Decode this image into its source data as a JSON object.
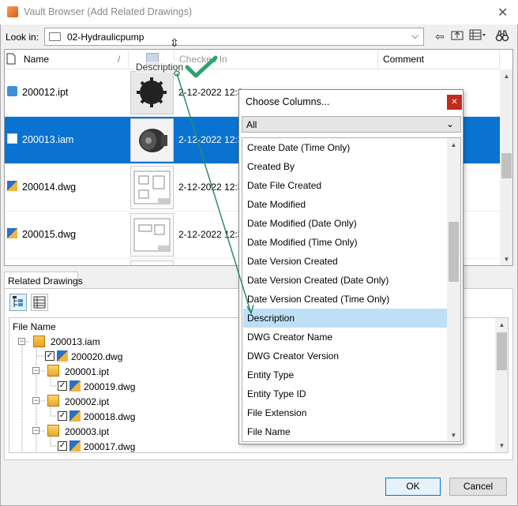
{
  "window": {
    "title": "Vault Browser (Add Related Drawings)",
    "close": "✕"
  },
  "lookin": {
    "label": "Look in:",
    "value": "02-Hydraulicpump",
    "chevron": "⌄"
  },
  "toolbar": {
    "back_icon": "⇦",
    "up_icon": "⇧",
    "views_icon": "☷",
    "find_icon": "binoculars-icon"
  },
  "grid": {
    "columns": [
      "Name",
      "",
      "Checked In",
      "Comment"
    ],
    "rows": [
      {
        "name": "200012.ipt",
        "date": "2-12-2022 12:3",
        "selected": false
      },
      {
        "name": "200013.iam",
        "date": "2-12-2022 12:3",
        "selected": true
      },
      {
        "name": "200014.dwg",
        "date": "2-12-2022 12:3",
        "selected": false
      },
      {
        "name": "200015.dwg",
        "date": "2-12-2022 12:3",
        "selected": false
      }
    ],
    "drag_label": "Description"
  },
  "related": {
    "tab_label": "Related Drawings",
    "tree_header": "File Name",
    "tree": [
      {
        "name": "200013.iam",
        "level": 0
      },
      {
        "name": "200020.dwg",
        "level": 1
      },
      {
        "name": "200001.ipt",
        "level": 1
      },
      {
        "name": "200019.dwg",
        "level": 2
      },
      {
        "name": "200002.ipt",
        "level": 1
      },
      {
        "name": "200018.dwg",
        "level": 2
      },
      {
        "name": "200003.ipt",
        "level": 1
      },
      {
        "name": "200017.dwg",
        "level": 2
      }
    ]
  },
  "buttons": {
    "ok": "OK",
    "cancel": "Cancel"
  },
  "choose_columns": {
    "title": "Choose Columns...",
    "filter": "All",
    "items": [
      "Create Date (Time Only)",
      "Created By",
      "Date File Created",
      "Date Modified",
      "Date Modified (Date Only)",
      "Date Modified (Time Only)",
      "Date Version Created",
      "Date Version Created (Date Only)",
      "Date Version Created (Time Only)",
      "Description",
      "DWG Creator Name",
      "DWG Creator Version",
      "Entity Type",
      "Entity Type ID",
      "File Extension",
      "File Name"
    ],
    "highlighted": "Description"
  },
  "colors": {
    "selection": "#0a73d2",
    "highlight": "#bee0f6",
    "check": "#2ea36f"
  }
}
